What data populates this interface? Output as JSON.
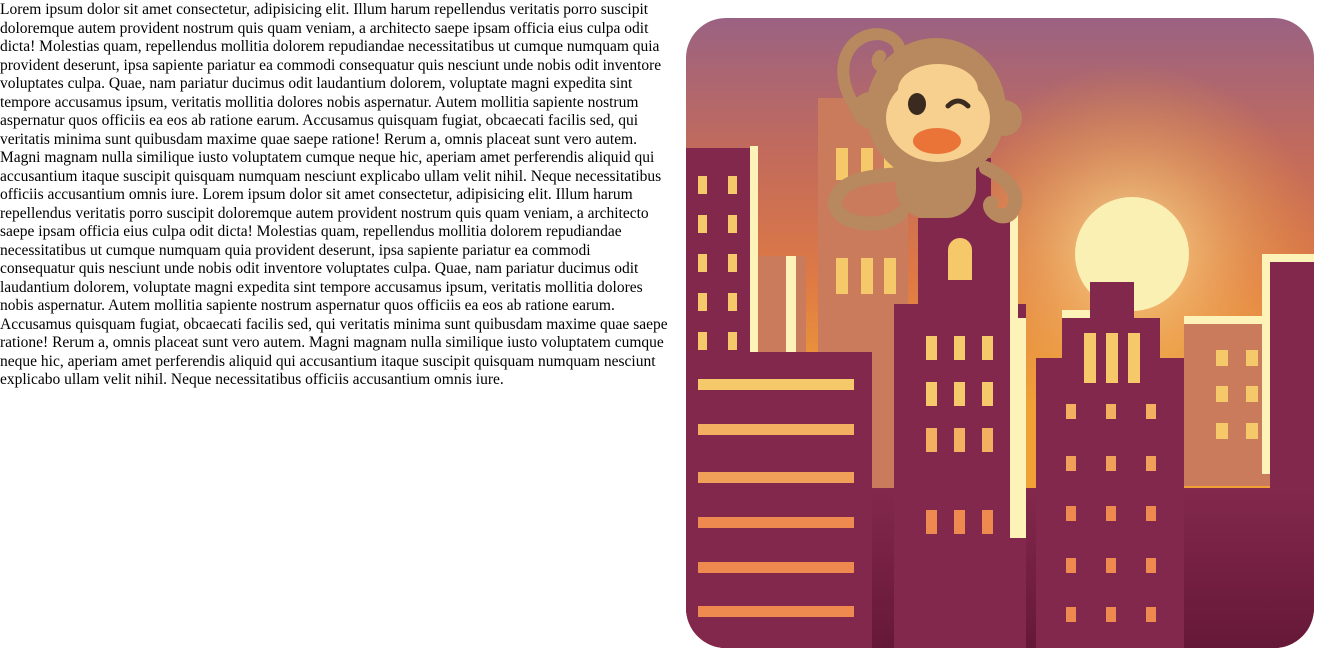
{
  "body_text": "Lorem ipsum dolor sit amet consectetur, adipisicing elit. Illum harum repellendus veritatis porro suscipit doloremque autem provident nostrum quis quam veniam, a architecto saepe ipsam officia eius culpa odit dicta! Molestias quam, repellendus mollitia dolorem repudiandae necessitatibus ut cumque numquam quia provident deserunt, ipsa sapiente pariatur ea commodi consequatur quis nesciunt unde nobis odit inventore voluptates culpa. Quae, nam pariatur ducimus odit laudantium dolorem, voluptate magni expedita sint tempore accusamus ipsum, veritatis mollitia dolores nobis aspernatur. Autem mollitia sapiente nostrum aspernatur quos officiis ea eos ab ratione earum. Accusamus quisquam fugiat, obcaecati facilis sed, qui veritatis minima sunt quibusdam maxime quae saepe ratione! Rerum a, omnis placeat sunt vero autem. Magni magnam nulla similique iusto voluptatem cumque neque hic, aperiam amet perferendis aliquid qui accusantium itaque suscipit quisquam numquam nesciunt explicabo ullam velit nihil. Neque necessitatibus officiis accusantium omnis iure. Lorem ipsum dolor sit amet consectetur, adipisicing elit. Illum harum repellendus veritatis porro suscipit doloremque autem provident nostrum quis quam veniam, a architecto saepe ipsam officia eius culpa odit dicta! Molestias quam, repellendus mollitia dolorem repudiandae necessitatibus ut cumque numquam quia provident deserunt, ipsa sapiente pariatur ea commodi consequatur quis nesciunt unde nobis odit inventore voluptates culpa. Quae, nam pariatur ducimus odit laudantium dolorem, voluptate magni expedita sint tempore accusamus ipsum, veritatis mollitia dolores nobis aspernatur. Autem mollitia sapiente nostrum aspernatur quos officiis ea eos ab ratione earum. Accusamus quisquam fugiat, obcaecati facilis sed, qui veritatis minima sunt quibusdam maxime quae saepe ratione! Rerum a, omnis placeat sunt vero autem. Magni magnam nulla similique iusto voluptatem cumque neque hic, aperiam amet perferendis aliquid qui accusantium itaque suscipit quisquam numquam nesciunt explicabo ullam velit nihil. Neque necessitatibus officiis accusantium omnis iure.",
  "illustration": {
    "icon": "monkey-on-city-skyline-at-sunset-icon",
    "colors": {
      "sky_top": "#9a6282",
      "sky_mid": "#d9714f",
      "sky_low": "#f0a236",
      "sun": "#fbf0b4",
      "building_dark": "#83284d",
      "building_darker": "#6c1a3a",
      "building_salmon": "#c97b5c",
      "window_yellow": "#f5c86a",
      "window_orange": "#ee8a50",
      "highlight_cream": "#fdf2b8",
      "monkey_fur": "#b8895e",
      "monkey_face": "#f7cf8e",
      "monkey_mouth": "#ea7437"
    }
  }
}
